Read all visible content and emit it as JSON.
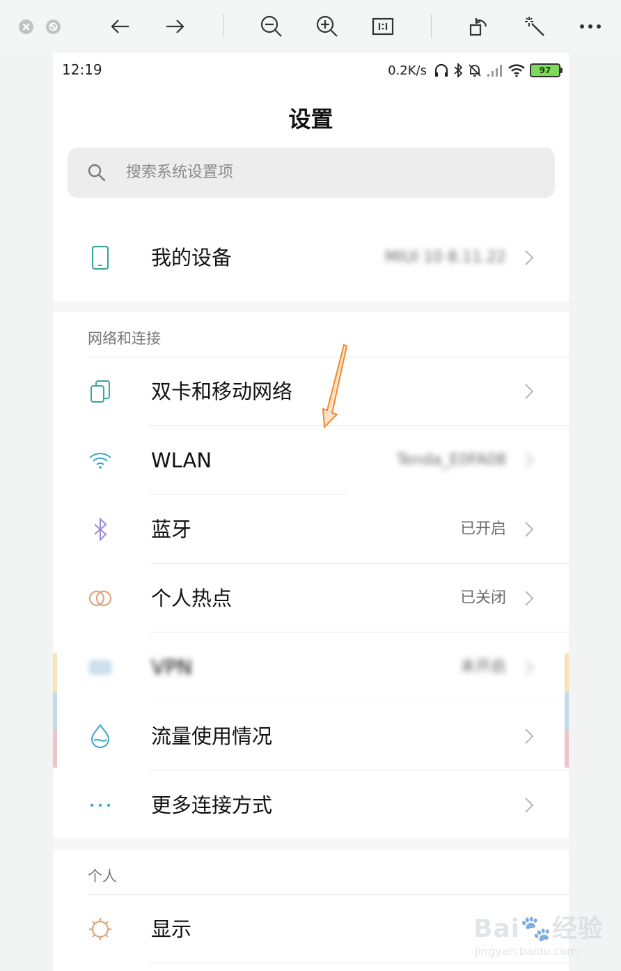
{
  "status_bar": {
    "time": "12:19",
    "net_speed": "0.2K/s",
    "battery": "97"
  },
  "header": {
    "title": "设置",
    "search_placeholder": "搜索系统设置项"
  },
  "device_row": {
    "label": "我的设备",
    "value": "MIUI 10 8.11.22"
  },
  "network_section": {
    "title": "网络和连接",
    "items": [
      {
        "label": "双卡和移动网络",
        "value": "",
        "icon": "dual-sim-icon"
      },
      {
        "label": "WLAN",
        "value": "Tenda_E0FA08",
        "icon": "wifi-icon"
      },
      {
        "label": "蓝牙",
        "value": "已开启",
        "icon": "bluetooth-icon"
      },
      {
        "label": "个人热点",
        "value": "已关闭",
        "icon": "hotspot-icon"
      },
      {
        "label": "VPN",
        "value": "未开启",
        "icon": "vpn-icon"
      },
      {
        "label": "流量使用情况",
        "value": "",
        "icon": "data-usage-icon"
      },
      {
        "label": "更多连接方式",
        "value": "",
        "icon": "more-dots-icon"
      }
    ]
  },
  "personal_section": {
    "title": "个人",
    "items": [
      {
        "label": "显示",
        "icon": "brightness-icon"
      }
    ]
  },
  "watermark": {
    "brand": "Bai",
    "brand_cn": "经验",
    "url": "jingyan.baidu.com"
  },
  "colors": {
    "accent_teal": "#3aa6a0",
    "arrow_orange": "#f08a2e",
    "bluetooth_purple": "#9b8ad6",
    "hotspot_orange": "#e2a47b"
  }
}
